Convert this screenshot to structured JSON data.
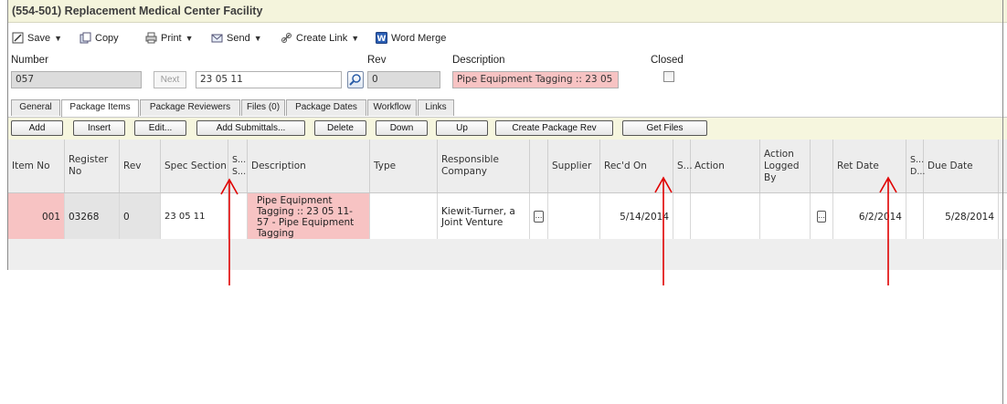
{
  "window": {
    "title": "(554-501) Replacement Medical Center Facility"
  },
  "toolbar": {
    "save": "Save",
    "copy": "Copy",
    "print": "Print",
    "send": "Send",
    "create_link": "Create Link",
    "word_merge": "Word Merge"
  },
  "form": {
    "number_label": "Number",
    "number_value": "057",
    "next_label": "Next",
    "spec_value": "23 05 11",
    "rev_label": "Rev",
    "rev_value": "0",
    "description_label": "Description",
    "description_value": "Pipe Equipment Tagging :: 23 05",
    "closed_label": "Closed"
  },
  "tabs": [
    "General",
    "Package Items",
    "Package Reviewers",
    "Files (0)",
    "Package Dates",
    "Workflow",
    "Links"
  ],
  "actions": [
    "Add",
    "Insert",
    "Edit...",
    "Add Submittals...",
    "Delete",
    "Down",
    "Up",
    "Create Package Rev",
    "Get Files"
  ],
  "grid": {
    "columns": [
      "Item No",
      "Register No",
      "Rev",
      "Spec Section",
      "S... S...",
      "Description",
      "Type",
      "Responsible Company",
      "",
      "Supplier",
      "Rec'd On",
      "S...",
      "Action",
      "Action Logged By",
      "",
      "Ret Date",
      "S... D...",
      "Due Date"
    ],
    "rows": [
      {
        "item_no": "001",
        "register_no": "03268",
        "rev": "0",
        "spec_section": "23 05 11",
        "description": "Pipe Equipment Tagging :: 23 05 11-57 - Pipe Equipment Tagging",
        "responsible_company": "Kiewit-Turner, a Joint Venture",
        "recd_on": "5/14/2014",
        "ret_date": "6/2/2014",
        "due_date": "5/28/2014"
      }
    ]
  },
  "colors": {
    "annotation_arrow": "#e00000",
    "highlight": "#f7c3c3",
    "toolbar_bg": "#f6f6de"
  }
}
